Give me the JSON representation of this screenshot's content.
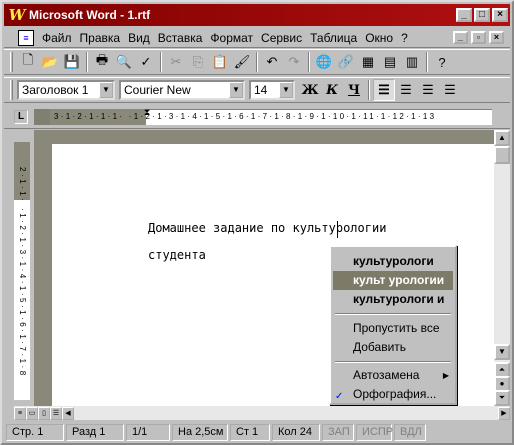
{
  "window": {
    "title": "Microsoft Word - 1.rtf",
    "app_icon": "W"
  },
  "menubar": {
    "items": [
      "Файл",
      "Правка",
      "Вид",
      "Вставка",
      "Формат",
      "Сервис",
      "Таблица",
      "Окно",
      "?"
    ]
  },
  "toolbar1": {
    "icons": [
      "new-doc-icon",
      "open-folder-icon",
      "save-icon",
      "print-icon",
      "print-preview-icon",
      "spelling-icon",
      "cut-icon",
      "copy-icon",
      "paste-icon",
      "format-painter-icon",
      "undo-icon",
      "redo-icon",
      "web-toolbar-icon",
      "hyperlink-icon",
      "tables-and-borders-icon",
      "insert-table-icon",
      "insert-excel-icon",
      "help-icon"
    ]
  },
  "toolbar2": {
    "style_value": "Заголовок 1",
    "font_value": "Courier New",
    "size_value": "14",
    "bold_label": "Ж",
    "italic_label": "К",
    "underline_label": "Ч"
  },
  "ruler": {
    "ticks": "3·1·2·1·1·1·   ·1·2·1·3·1·4·1·5·1·6·1·7·1·8·1·9·1·10·1·11·1·12·1·13"
  },
  "vruler": {
    "ticks": "2·1·1·   ·1·2·1·3·1·4·1·5·1·6·1·7·1·8"
  },
  "document": {
    "line1": "Домашнее задание по культурологии",
    "line2": "студента"
  },
  "context_menu": {
    "suggestions": [
      "культурологи",
      "культ урологии",
      "культурологи и"
    ],
    "ignore_all": "Пропустить все",
    "add": "Добавить",
    "autocorrect": "Автозамена",
    "spelling": "Орфография..."
  },
  "statusbar": {
    "page": "Стр. 1",
    "section": "Разд 1",
    "pages": "1/1",
    "at": "На 2,5см",
    "line": "Ст 1",
    "col": "Кол 24",
    "rec": "ЗАП",
    "trk": "ИСПР",
    "ext": "ВДЛ"
  },
  "colors": {
    "title_bar": "#800000",
    "selection": "#7d7a68",
    "chrome": "#c0c0c0"
  }
}
